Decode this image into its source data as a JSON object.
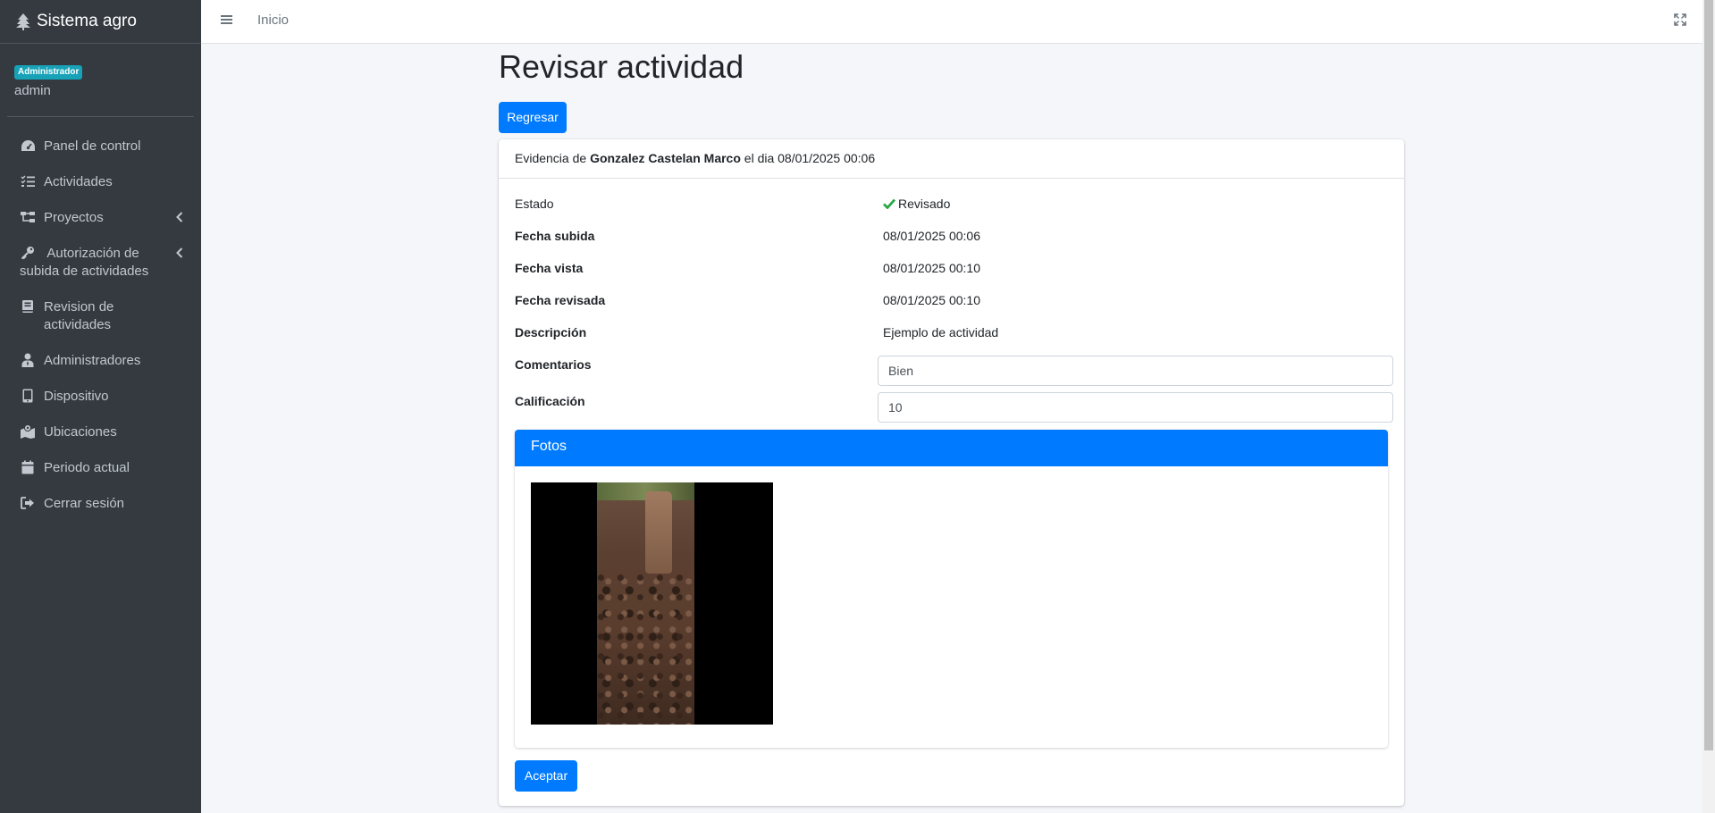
{
  "app": {
    "brand": "Sistema agro"
  },
  "user": {
    "role_badge": "Administrador",
    "name": "admin"
  },
  "sidebar": {
    "items": [
      {
        "label": "Panel de control"
      },
      {
        "label": "Actividades"
      },
      {
        "label": "Proyectos"
      },
      {
        "label": "Autorización de subida de actividades"
      },
      {
        "label": "Revision de actividades"
      },
      {
        "label": "Administradores"
      },
      {
        "label": "Dispositivo"
      },
      {
        "label": "Ubicaciones"
      },
      {
        "label": "Periodo actual"
      },
      {
        "label": "Cerrar sesión"
      }
    ]
  },
  "topbar": {
    "home_link": "Inicio"
  },
  "page": {
    "title": "Revisar actividad",
    "back_button": "Regresar",
    "accept_button": "Aceptar"
  },
  "evidence": {
    "prefix": "Evidencia de",
    "person": "Gonzalez Castelan Marco",
    "suffix": "el dia 08/01/2025 00:06"
  },
  "details": {
    "estado_label": "Estado",
    "estado_value": "Revisado",
    "fecha_subida_label": "Fecha subida",
    "fecha_subida_value": "08/01/2025 00:06",
    "fecha_vista_label": "Fecha vista",
    "fecha_vista_value": "08/01/2025 00:10",
    "fecha_revisada_label": "Fecha revisada",
    "fecha_revisada_value": "08/01/2025 00:10",
    "descripcion_label": "Descripción",
    "descripcion_value": "Ejemplo de actividad",
    "comentarios_label": "Comentarios",
    "comentarios_value": "Bien",
    "calificacion_label": "Calificación",
    "calificacion_value": "10"
  },
  "photos": {
    "header": "Fotos"
  },
  "colors": {
    "primary": "#007bff",
    "sidebar": "#343a40",
    "success": "#28a745",
    "badge": "#17a2b8"
  }
}
